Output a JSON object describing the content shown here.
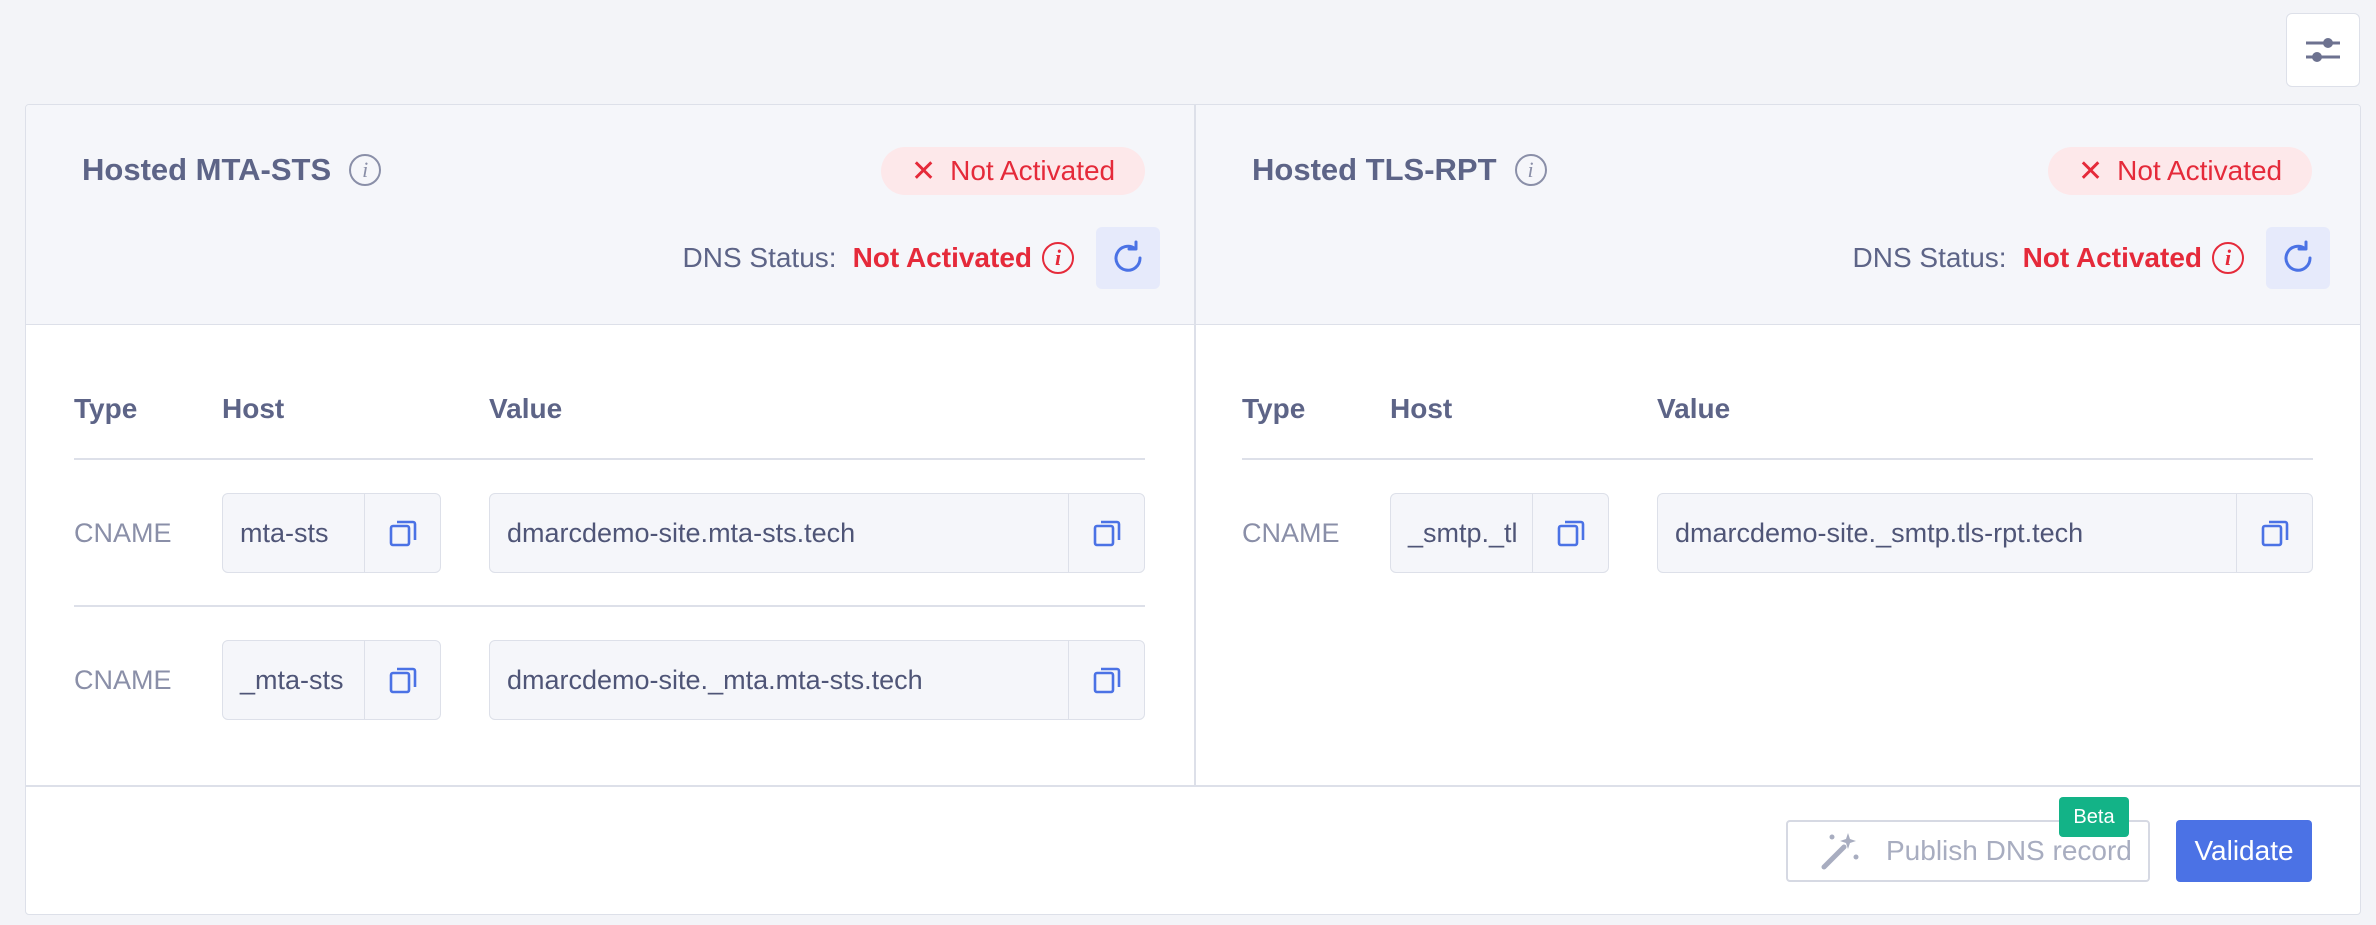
{
  "left_panel": {
    "title": "Hosted MTA-STS",
    "badge": "Not Activated",
    "dns_label": "DNS Status:",
    "dns_value": "Not Activated",
    "columns": [
      "Type",
      "Host",
      "Value"
    ],
    "rows": [
      {
        "type": "CNAME",
        "host": "mta-sts",
        "value": "dmarcdemo-site.mta-sts.tech"
      },
      {
        "type": "CNAME",
        "host": "_mta-sts",
        "value": "dmarcdemo-site._mta.mta-sts.tech"
      }
    ]
  },
  "right_panel": {
    "title": "Hosted TLS-RPT",
    "badge": "Not Activated",
    "dns_label": "DNS Status:",
    "dns_value": "Not Activated",
    "columns": [
      "Type",
      "Host",
      "Value"
    ],
    "rows": [
      {
        "type": "CNAME",
        "host": "_smtp._tl",
        "value": "dmarcdemo-site._smtp.tls-rpt.tech"
      }
    ]
  },
  "footer": {
    "publish_label": "Publish DNS record",
    "beta_label": "Beta",
    "validate_label": "Validate"
  },
  "icons": {
    "info": "i",
    "close": "✕"
  },
  "colors": {
    "accent": "#4b72e5",
    "error": "#e52a3a",
    "beta": "#13b387"
  }
}
